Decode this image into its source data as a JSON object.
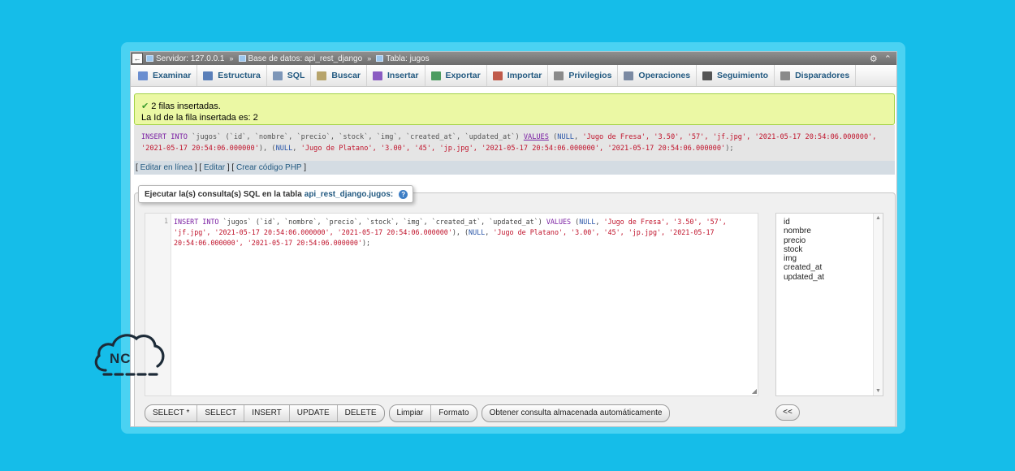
{
  "breadcrumb": {
    "server": "Servidor: 127.0.0.1",
    "database": "Base de datos: api_rest_django",
    "table": "Tabla: jugos"
  },
  "tabs": [
    {
      "label": "Examinar",
      "icon": "browse-icon",
      "color": "#6a8ed0"
    },
    {
      "label": "Estructura",
      "icon": "structure-icon",
      "color": "#5a7fb9"
    },
    {
      "label": "SQL",
      "icon": "sql-icon",
      "color": "#7d96b8"
    },
    {
      "label": "Buscar",
      "icon": "search-icon",
      "color": "#b7a46b"
    },
    {
      "label": "Insertar",
      "icon": "insert-icon",
      "color": "#8a5cc2"
    },
    {
      "label": "Exportar",
      "icon": "export-icon",
      "color": "#4c9c60"
    },
    {
      "label": "Importar",
      "icon": "import-icon",
      "color": "#c05a4a"
    },
    {
      "label": "Privilegios",
      "icon": "privileges-icon",
      "color": "#8b8b8b"
    },
    {
      "label": "Operaciones",
      "icon": "operations-icon",
      "color": "#7b8aa3"
    },
    {
      "label": "Seguimiento",
      "icon": "tracking-icon",
      "color": "#555555"
    },
    {
      "label": "Disparadores",
      "icon": "triggers-icon",
      "color": "#8a8a8a"
    }
  ],
  "success": {
    "line1": "2 filas insertadas.",
    "line2": "La Id de la fila insertada es: 2"
  },
  "result_sql": {
    "p1": "INSERT INTO",
    "p2": " `jugos` (`id`, `nombre`, `precio`, `stock`, `img`, `created_at`, `updated_at`) ",
    "p3": "VALUES",
    "p4": " (",
    "p5": "NULL",
    "p6": ", ",
    "p7": "'Jugo de Fresa', '3.50', '57', 'jf.jpg', '2021-05-17 20:54:06.000000',",
    "p8": "'2021-05-17 20:54:06.000000'",
    "p9": "), (",
    "p10": "NULL",
    "p11": ", ",
    "p12": "'Jugo de Platano', '3.00', '45', 'jp.jpg', '2021-05-17 20:54:06.000000', '2021-05-17 20:54:06.000000'",
    "p13": ");"
  },
  "edit_links": {
    "inline": "Editar en línea",
    "edit": "Editar",
    "php": "Crear código PHP"
  },
  "query_panel": {
    "legend_prefix": "Ejecutar la(s) consulta(s) SQL en la tabla",
    "legend_table": "api_rest_django.jugos:",
    "line_number": "1",
    "code": {
      "kw1": "INSERT INTO",
      "t1": " `jugos` (`id`, `nombre`, `precio`, `stock`, `img`, `created_at`, `updated_at`) ",
      "kw2": "VALUES",
      "t2": " (",
      "fn1": "NULL",
      "t3": ", ",
      "s1": "'Jugo de Fresa', '3.50', '57', 'jf.jpg', '2021-05-17 20:54:06.000000', '2021-05-17 20:54:06.000000'",
      "t4": "), (",
      "fn2": "NULL",
      "t5": ", ",
      "s2": "'Jugo de Platano', '3.00', '45', 'jp.jpg', '2021-05-17 20:54:06.000000', '2021-05-17 20:54:06.000000'",
      "t6": ");"
    },
    "columns": [
      "id",
      "nombre",
      "precio",
      "stock",
      "img",
      "created_at",
      "updated_at"
    ]
  },
  "buttons": {
    "group1": [
      "SELECT *",
      "SELECT",
      "INSERT",
      "UPDATE",
      "DELETE"
    ],
    "group2": [
      "Limpiar",
      "Formato"
    ],
    "group3": [
      "Obtener consulta almacenada automáticamente"
    ],
    "back": "<<"
  },
  "logo": {
    "text": "NC"
  }
}
